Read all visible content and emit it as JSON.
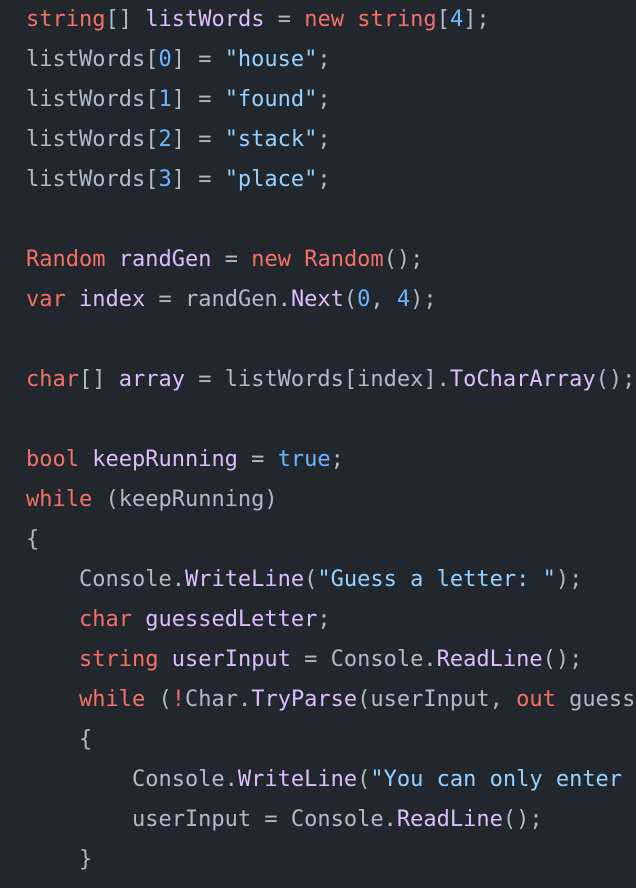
{
  "colors": {
    "background": "#22272e",
    "keyword": "#f47067",
    "plain": "#adbac7",
    "identifier": "#dcbdfb",
    "method": "#dcbdfb",
    "string": "#96d0ff",
    "number": "#6cb6ff",
    "constant": "#6cb6ff"
  },
  "lines": [
    [
      {
        "t": "string",
        "k": "keyword"
      },
      {
        "t": "[] ",
        "k": "plain"
      },
      {
        "t": "listWords",
        "k": "identifier"
      },
      {
        "t": " = ",
        "k": "plain"
      },
      {
        "t": "new",
        "k": "keyword"
      },
      {
        "t": " ",
        "k": "plain"
      },
      {
        "t": "string",
        "k": "keyword"
      },
      {
        "t": "[",
        "k": "plain"
      },
      {
        "t": "4",
        "k": "number"
      },
      {
        "t": "];",
        "k": "plain"
      }
    ],
    [
      {
        "t": "listWords[",
        "k": "plain"
      },
      {
        "t": "0",
        "k": "number"
      },
      {
        "t": "] = ",
        "k": "plain"
      },
      {
        "t": "\"house\"",
        "k": "string"
      },
      {
        "t": ";",
        "k": "plain"
      }
    ],
    [
      {
        "t": "listWords[",
        "k": "plain"
      },
      {
        "t": "1",
        "k": "number"
      },
      {
        "t": "] = ",
        "k": "plain"
      },
      {
        "t": "\"found\"",
        "k": "string"
      },
      {
        "t": ";",
        "k": "plain"
      }
    ],
    [
      {
        "t": "listWords[",
        "k": "plain"
      },
      {
        "t": "2",
        "k": "number"
      },
      {
        "t": "] = ",
        "k": "plain"
      },
      {
        "t": "\"stack\"",
        "k": "string"
      },
      {
        "t": ";",
        "k": "plain"
      }
    ],
    [
      {
        "t": "listWords[",
        "k": "plain"
      },
      {
        "t": "3",
        "k": "number"
      },
      {
        "t": "] = ",
        "k": "plain"
      },
      {
        "t": "\"place\"",
        "k": "string"
      },
      {
        "t": ";",
        "k": "plain"
      }
    ],
    [],
    [
      {
        "t": "Random",
        "k": "keyword"
      },
      {
        "t": " ",
        "k": "plain"
      },
      {
        "t": "randGen",
        "k": "identifier"
      },
      {
        "t": " = ",
        "k": "plain"
      },
      {
        "t": "new",
        "k": "keyword"
      },
      {
        "t": " ",
        "k": "plain"
      },
      {
        "t": "Random",
        "k": "keyword"
      },
      {
        "t": "();",
        "k": "plain"
      }
    ],
    [
      {
        "t": "var",
        "k": "keyword"
      },
      {
        "t": " ",
        "k": "plain"
      },
      {
        "t": "index",
        "k": "identifier"
      },
      {
        "t": " = randGen.",
        "k": "plain"
      },
      {
        "t": "Next",
        "k": "method"
      },
      {
        "t": "(",
        "k": "plain"
      },
      {
        "t": "0",
        "k": "number"
      },
      {
        "t": ", ",
        "k": "plain"
      },
      {
        "t": "4",
        "k": "number"
      },
      {
        "t": ");",
        "k": "plain"
      }
    ],
    [],
    [
      {
        "t": "char",
        "k": "keyword"
      },
      {
        "t": "[] ",
        "k": "plain"
      },
      {
        "t": "array",
        "k": "identifier"
      },
      {
        "t": " = listWords[index].",
        "k": "plain"
      },
      {
        "t": "ToCharArray",
        "k": "method"
      },
      {
        "t": "();",
        "k": "plain"
      }
    ],
    [],
    [
      {
        "t": "bool",
        "k": "keyword"
      },
      {
        "t": " ",
        "k": "plain"
      },
      {
        "t": "keepRunning",
        "k": "identifier"
      },
      {
        "t": " = ",
        "k": "plain"
      },
      {
        "t": "true",
        "k": "constant"
      },
      {
        "t": ";",
        "k": "plain"
      }
    ],
    [
      {
        "t": "while",
        "k": "keyword"
      },
      {
        "t": " (keepRunning)",
        "k": "plain"
      }
    ],
    [
      {
        "t": "{",
        "k": "plain"
      }
    ],
    [
      {
        "t": "    Console.",
        "k": "plain"
      },
      {
        "t": "WriteLine",
        "k": "method"
      },
      {
        "t": "(",
        "k": "plain"
      },
      {
        "t": "\"Guess a letter: \"",
        "k": "string"
      },
      {
        "t": ");",
        "k": "plain"
      }
    ],
    [
      {
        "t": "    ",
        "k": "plain"
      },
      {
        "t": "char",
        "k": "keyword"
      },
      {
        "t": " ",
        "k": "plain"
      },
      {
        "t": "guessedLetter",
        "k": "identifier"
      },
      {
        "t": ";",
        "k": "plain"
      }
    ],
    [
      {
        "t": "    ",
        "k": "plain"
      },
      {
        "t": "string",
        "k": "keyword"
      },
      {
        "t": " ",
        "k": "plain"
      },
      {
        "t": "userInput",
        "k": "identifier"
      },
      {
        "t": " = Console.",
        "k": "plain"
      },
      {
        "t": "ReadLine",
        "k": "method"
      },
      {
        "t": "();",
        "k": "plain"
      }
    ],
    [
      {
        "t": "    ",
        "k": "plain"
      },
      {
        "t": "while",
        "k": "keyword"
      },
      {
        "t": " (",
        "k": "plain"
      },
      {
        "t": "!",
        "k": "keyword"
      },
      {
        "t": "Char.",
        "k": "plain"
      },
      {
        "t": "TryParse",
        "k": "method"
      },
      {
        "t": "(userInput, ",
        "k": "plain"
      },
      {
        "t": "out",
        "k": "keyword"
      },
      {
        "t": " guesse",
        "k": "plain"
      }
    ],
    [
      {
        "t": "    {",
        "k": "plain"
      }
    ],
    [
      {
        "t": "        Console.",
        "k": "plain"
      },
      {
        "t": "WriteLine",
        "k": "method"
      },
      {
        "t": "(",
        "k": "plain"
      },
      {
        "t": "\"You can only enter (",
        "k": "string"
      }
    ],
    [
      {
        "t": "        userInput = Console.",
        "k": "plain"
      },
      {
        "t": "ReadLine",
        "k": "method"
      },
      {
        "t": "();",
        "k": "plain"
      }
    ],
    [
      {
        "t": "    }",
        "k": "plain"
      }
    ]
  ]
}
